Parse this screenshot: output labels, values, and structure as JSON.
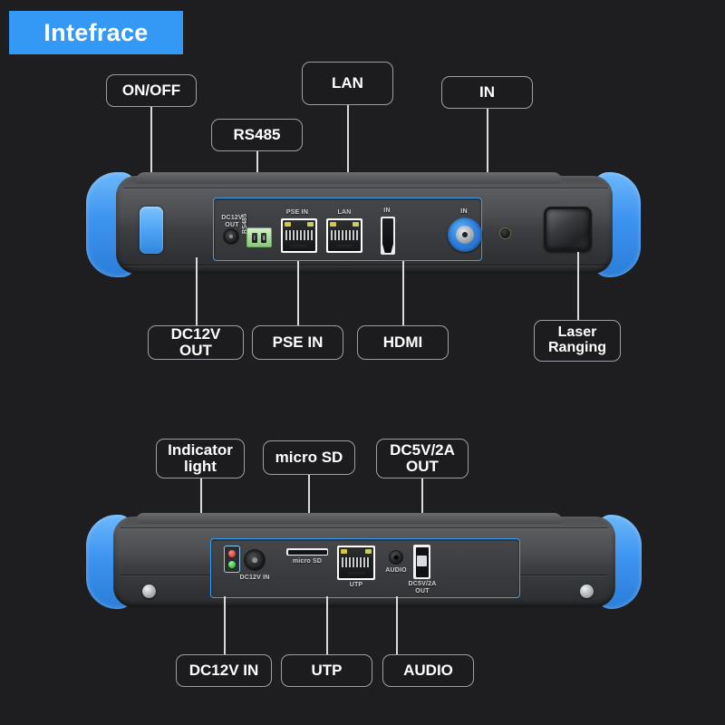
{
  "banner": {
    "title": "Intefrace",
    "background_color": "#3399f5",
    "text_color": "#ffffff"
  },
  "theme": {
    "page_background": "#1e1e20",
    "callout_border": "#9aa0a6",
    "callout_text": "#ffffff",
    "leader_line": "#d8dadd",
    "panel_outline": "#3aa0f2",
    "bumper_blue": "#3d93f0",
    "chassis_grey": "#3c3e41",
    "silkscreen_text": "#cfd2d6",
    "led_red": "#c52020",
    "led_green": "#1f9b2a",
    "terminal_green": "#a8d89a"
  },
  "top_device": {
    "name": "top-panel-view",
    "callouts_above": [
      {
        "id": "on-off",
        "label": "ON/OFF"
      },
      {
        "id": "rs485",
        "label": "RS485"
      },
      {
        "id": "lan",
        "label": "LAN"
      },
      {
        "id": "in",
        "label": "IN"
      }
    ],
    "callouts_below": [
      {
        "id": "dc12v-out",
        "label": "DC12V OUT"
      },
      {
        "id": "pse-in",
        "label": "PSE IN"
      },
      {
        "id": "hdmi",
        "label": "HDMI"
      },
      {
        "id": "laser-ranging",
        "label": "Laser\nRanging"
      }
    ],
    "silkscreen": [
      {
        "id": "dc12v-out-silk",
        "text": "DC12V\nOUT"
      },
      {
        "id": "rs485-silk",
        "text": "RS485"
      },
      {
        "id": "pse-in-silk",
        "text": "PSE IN"
      },
      {
        "id": "lan-silk",
        "text": "LAN"
      },
      {
        "id": "hdmi-in-silk",
        "text": "IN"
      },
      {
        "id": "bnc-in-silk",
        "text": "IN"
      }
    ]
  },
  "bottom_device": {
    "name": "bottom-panel-view",
    "callouts_above": [
      {
        "id": "indicator-light",
        "label": "Indicator\nlight"
      },
      {
        "id": "micro-sd",
        "label": "micro SD"
      },
      {
        "id": "dc5v-2a-out",
        "label": "DC5V/2A\nOUT"
      }
    ],
    "callouts_below": [
      {
        "id": "dc12v-in",
        "label": "DC12V IN"
      },
      {
        "id": "utp",
        "label": "UTP"
      },
      {
        "id": "audio",
        "label": "AUDIO"
      }
    ],
    "silkscreen": [
      {
        "id": "dc12v-in-silk",
        "text": "DC12V IN"
      },
      {
        "id": "micro-sd-silk",
        "text": "micro SD"
      },
      {
        "id": "utp-silk",
        "text": "UTP"
      },
      {
        "id": "audio-silk",
        "text": "AUDIO"
      },
      {
        "id": "dc5v-2a-silk",
        "text": "DC5V/2A\nOUT"
      }
    ]
  }
}
